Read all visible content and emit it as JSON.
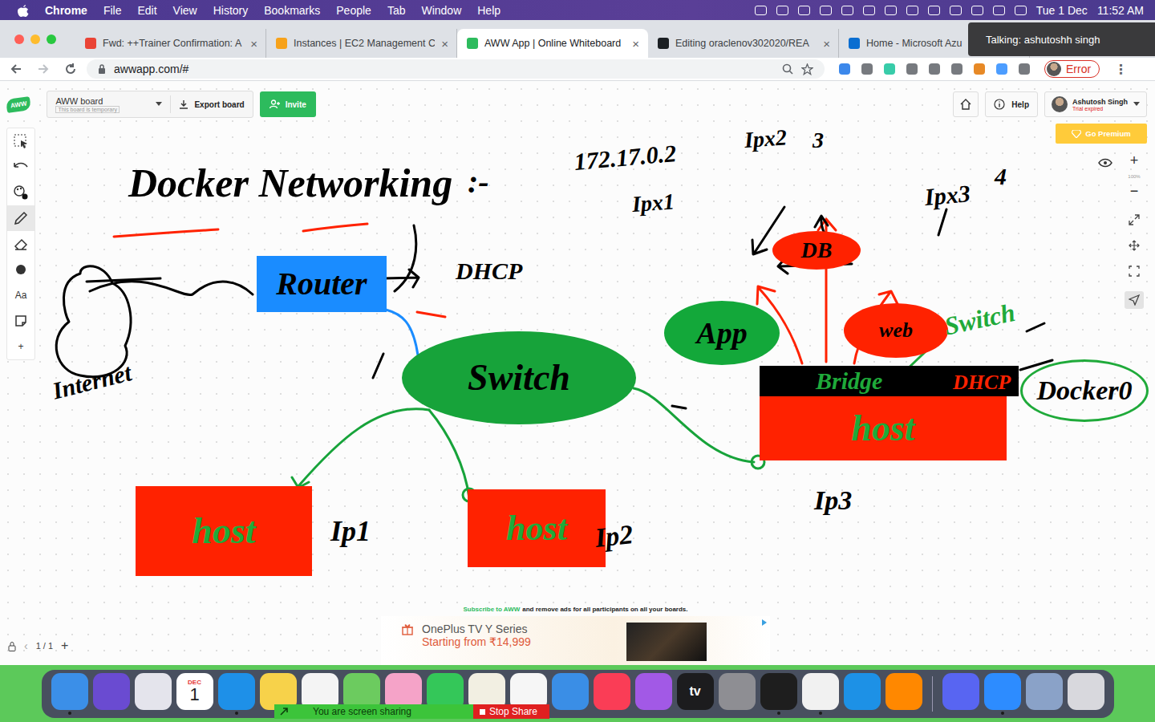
{
  "menubar": {
    "app": "Chrome",
    "items": [
      "File",
      "Edit",
      "View",
      "History",
      "Bookmarks",
      "People",
      "Tab",
      "Window",
      "Help"
    ],
    "date": "Tue 1 Dec",
    "time": "11:52 AM"
  },
  "browser": {
    "tabs": [
      {
        "label": "Fwd: ++Trainer Confirmation: A",
        "close": "×",
        "selected": false,
        "color": "#ea4335"
      },
      {
        "label": "Instances | EC2 Management C",
        "close": "×",
        "selected": false,
        "color": "#f7a21b"
      },
      {
        "label": "AWW App | Online Whiteboard",
        "close": "×",
        "selected": true,
        "color": "#2dbb5d"
      },
      {
        "label": "Editing oraclenov302020/REA",
        "close": "×",
        "selected": false,
        "color": "#1b1f23"
      },
      {
        "label": "Home - Microsoft Azu",
        "close": "×",
        "selected": false,
        "color": "#0a6ed1"
      }
    ],
    "tooltip": "Talking: ashutoshh singh",
    "url": "awwapp.com/#",
    "profile": "Error",
    "menu": "⋮"
  },
  "app": {
    "logo": "AWW",
    "board": {
      "name": "AWW board",
      "note": "This board is temporary"
    },
    "export": "Export board",
    "invite": "Invite",
    "help": "Help",
    "user": {
      "name": "Ashutosh Singh",
      "status": "Trial expired"
    },
    "premium": "Go Premium",
    "tools": [
      {
        "kind": "select",
        "label": "",
        "selected": false
      },
      {
        "kind": "undo",
        "label": "",
        "selected": false
      },
      {
        "kind": "color",
        "label": "",
        "selected": false
      },
      {
        "kind": "pen",
        "label": "",
        "selected": true
      },
      {
        "kind": "eraser",
        "label": "",
        "selected": false
      },
      {
        "kind": "shape",
        "label": "",
        "selected": false
      },
      {
        "kind": "text",
        "label": "Aa",
        "selected": false
      },
      {
        "kind": "note",
        "label": "",
        "selected": false
      },
      {
        "kind": "add",
        "label": "+",
        "selected": false
      }
    ],
    "zoom": {
      "in": "+",
      "level": "100%",
      "out": "−"
    },
    "pager": {
      "prev": "‹",
      "page": "1 / 1",
      "add": "+"
    }
  },
  "canvas": {
    "nodes": [
      {
        "label": "Router",
        "kind": "rect",
        "color": "#1a8cff",
        "ink": "#000000"
      },
      {
        "label": "Switch",
        "kind": "ellipse",
        "color": "#17a33a",
        "ink": "#000000"
      },
      {
        "label": "host",
        "kind": "rect",
        "color": "#ff2200",
        "ink": "#1faa3a"
      },
      {
        "label": "host",
        "kind": "rect",
        "color": "#ff2200",
        "ink": "#1faa3a"
      },
      {
        "label": "App",
        "kind": "ellipse",
        "color": "#13a83a",
        "ink": "#000000"
      },
      {
        "label": "DB",
        "kind": "ellipse",
        "color": "#ff2200",
        "ink": "#000000"
      },
      {
        "label": "web",
        "kind": "ellipse",
        "color": "#ff2200",
        "ink": "#000000"
      },
      {
        "label": "host",
        "kind": "rect",
        "color": "#ff2200",
        "ink": "#1faa3a"
      },
      {
        "label": "Bridge",
        "kind": "bar",
        "color": "#000000",
        "ink": "#1faa3a"
      },
      {
        "label": "Docker0",
        "kind": "outline",
        "color": "#1faa3a",
        "ink": "#000000"
      }
    ],
    "labels": [
      {
        "text": "Docker Networking",
        "ink": "#000000"
      },
      {
        "text": ":-",
        "ink": "#000000"
      },
      {
        "text": "DHCP",
        "ink": "#000000"
      },
      {
        "text": "Internet",
        "ink": "#000000"
      },
      {
        "text": "Ip1",
        "ink": "#000000"
      },
      {
        "text": "Ip2",
        "ink": "#000000"
      },
      {
        "text": "Ip3",
        "ink": "#000000"
      },
      {
        "text": "172.17.0.2",
        "ink": "#000000"
      },
      {
        "text": "Ipx1",
        "ink": "#000000"
      },
      {
        "text": "Ipx2",
        "ink": "#000000"
      },
      {
        "text": "3",
        "ink": "#000000"
      },
      {
        "text": "Ipx3",
        "ink": "#000000"
      },
      {
        "text": "4",
        "ink": "#000000"
      },
      {
        "text": "Switch",
        "ink": "#1faa3a"
      },
      {
        "text": "DHCP",
        "ink": "#ff2200"
      }
    ]
  },
  "ad": {
    "link": "Subscribe to AWW",
    "rest": "and remove ads for all participants on all your boards.",
    "product": "OnePlus TV Y Series",
    "price": "Starting from ₹14,999"
  },
  "dock": {
    "apps": [
      {
        "kind": "app",
        "color": "#3b8fe8",
        "running": true
      },
      {
        "kind": "app",
        "color": "#6a4bd1",
        "running": false
      },
      {
        "kind": "app",
        "color": "#e4e4ec",
        "running": false
      },
      {
        "kind": "calendar",
        "color": "#ffffff",
        "running": false,
        "month": "DEC",
        "day": "1"
      },
      {
        "kind": "app",
        "color": "#1e90e8",
        "running": true
      },
      {
        "kind": "app",
        "color": "#f7d24a",
        "running": false
      },
      {
        "kind": "app",
        "color": "#f4f4f4",
        "running": false
      },
      {
        "kind": "app",
        "color": "#6ccb5f",
        "running": false
      },
      {
        "kind": "app",
        "color": "#f5a3c8",
        "running": false
      },
      {
        "kind": "app",
        "color": "#34c759",
        "running": false
      },
      {
        "kind": "app",
        "color": "#f2efe2",
        "running": false
      },
      {
        "kind": "app",
        "color": "#f6f6f6",
        "running": false
      },
      {
        "kind": "app",
        "color": "#3a8ee6",
        "running": false
      },
      {
        "kind": "app",
        "color": "#fa3d56",
        "running": false
      },
      {
        "kind": "app",
        "color": "#a259e6",
        "running": false
      },
      {
        "kind": "tv",
        "color": "#1c1c1e",
        "running": false,
        "label": "tv"
      },
      {
        "kind": "app",
        "color": "#8e8e93",
        "running": false
      },
      {
        "kind": "app",
        "color": "#1e1e1e",
        "running": true
      },
      {
        "kind": "app",
        "color": "#f1f1f1",
        "running": true
      },
      {
        "kind": "app",
        "color": "#1d91e6",
        "running": false
      },
      {
        "kind": "app",
        "color": "#ff8800",
        "running": false
      },
      {
        "kind": "separator",
        "color": "#9a98b0",
        "running": false
      },
      {
        "kind": "app",
        "color": "#5865f2",
        "running": false
      },
      {
        "kind": "app",
        "color": "#2d8cff",
        "running": true
      },
      {
        "kind": "app",
        "color": "#8aa2c8",
        "running": false
      },
      {
        "kind": "app",
        "color": "#d8d8dd",
        "running": false
      }
    ]
  },
  "sharing": {
    "status": "You are screen sharing",
    "stop": "Stop Share"
  }
}
